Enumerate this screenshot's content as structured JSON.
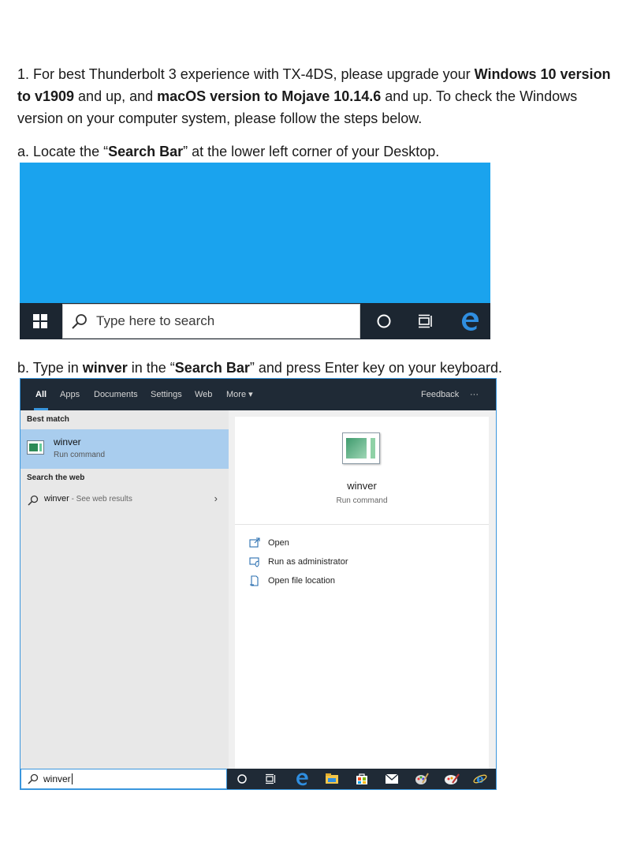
{
  "para1": {
    "prefix": "1. For best Thunderbolt 3 experience with TX-4DS, please upgrade your ",
    "bold1": "Windows 10 version to v1909",
    "mid": " and up, and ",
    "bold2": "macOS version to Mojave 10.14.6",
    "suffix": " and up. To check the Windows version on your computer system, please follow the steps below."
  },
  "stepA": {
    "prefix": "a. Locate the “",
    "bold": "Search Bar",
    "suffix": "” at the lower left corner of your Desktop."
  },
  "stepB": {
    "prefix": "b. Type in ",
    "bold1": "winver",
    "mid": " in the “",
    "bold2": "Search Bar",
    "suffix": "” and press Enter key on your keyboard."
  },
  "screenshotA": {
    "search_placeholder": "Type here to search"
  },
  "screenshotB": {
    "tabs": [
      "All",
      "Apps",
      "Documents",
      "Settings",
      "Web",
      "More ▾"
    ],
    "feedback": "Feedback",
    "more_dots": "···",
    "best_match_label": "Best match",
    "best_match_title": "winver",
    "best_match_subtitle": "Run command",
    "search_web_label": "Search the web",
    "web_query": "winver",
    "web_suffix": " - See web results",
    "chevron": "›",
    "right_title": "winver",
    "right_subtitle": "Run command",
    "actions": [
      "Open",
      "Run as administrator",
      "Open file location"
    ],
    "search_value": "winver"
  },
  "colors": {
    "desktop_blue": "#1aa3ee",
    "taskbar_dark": "#1c2631",
    "selection_blue": "#a9cdee",
    "accent_blue": "#3a96dd"
  }
}
